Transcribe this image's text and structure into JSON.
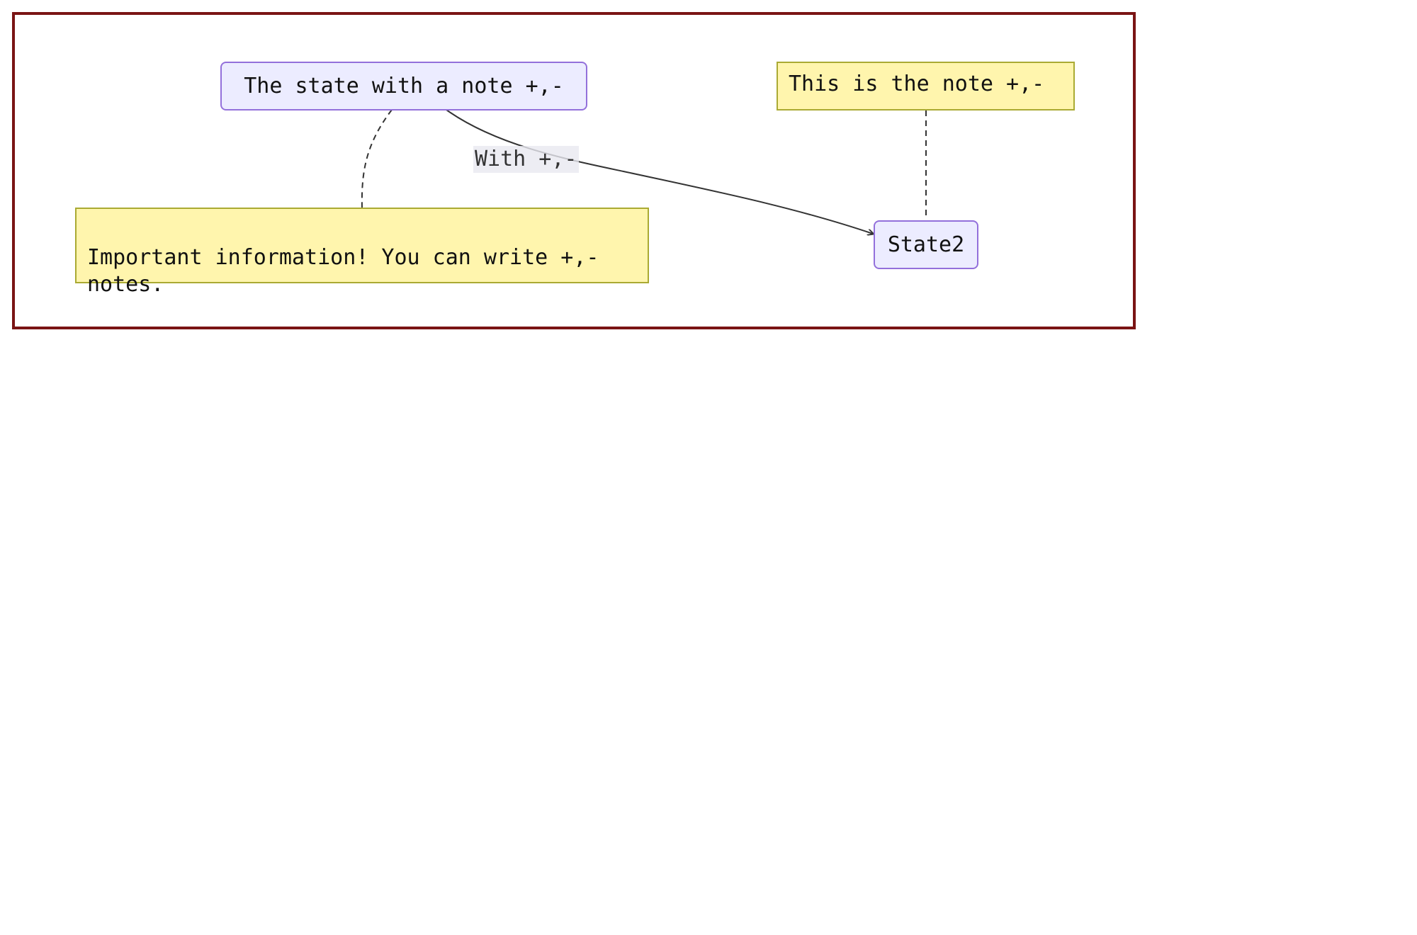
{
  "states": {
    "state1": {
      "label": "The state with a note +,-"
    },
    "state2": {
      "label": "State2"
    }
  },
  "notes": {
    "note_state1": {
      "text": "Important information! You can write +,-\nnotes."
    },
    "note_state2": {
      "text": "This is the note +,-"
    }
  },
  "transitions": [
    {
      "from": "state1",
      "to": "state2",
      "label": "With +,-"
    }
  ],
  "colors": {
    "frame_border": "#7a1414",
    "state_fill": "#ECECFF",
    "state_border": "#9370DB",
    "note_fill": "#FFF5AD",
    "note_border": "#AAAA33",
    "edge": "#333333"
  }
}
